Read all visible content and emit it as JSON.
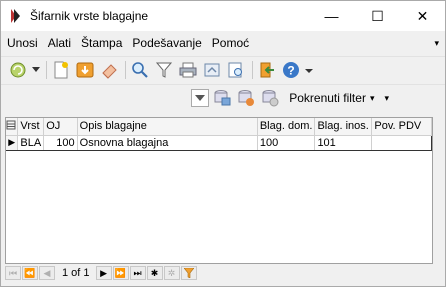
{
  "window": {
    "title": "Šifarnik vrste blagajne"
  },
  "titlebar_controls": {
    "minimize": "—",
    "maximize": "☐",
    "close": "✕"
  },
  "menu": [
    {
      "label": "Unosi"
    },
    {
      "label": "Alati"
    },
    {
      "label": "Štampa"
    },
    {
      "label": "Podešavanje"
    },
    {
      "label": "Pomoć"
    }
  ],
  "menu_overflow": "▾",
  "toolbar1_icons": [
    "refresh-icon",
    "dropdown-arrow-icon",
    "new-document-icon",
    "save-icon",
    "eraser-icon",
    "search-icon",
    "filter-icon",
    "print-icon",
    "export-icon",
    "preview-icon",
    "exit-icon",
    "help-icon",
    "overflow-icon"
  ],
  "toolbar2": {
    "filter_label": "Pokrenuti filter",
    "filter_arrow": "▾",
    "overflow": "▾"
  },
  "grid": {
    "columns": [
      "Vrst",
      "OJ",
      "Opis blagajne",
      "Blag. dom.",
      "Blag. inos.",
      "Pov. PDV"
    ],
    "rows": [
      {
        "indicator": "▶",
        "cells": [
          "BLA",
          "100",
          "Osnovna blagajna",
          "100",
          "101",
          ""
        ]
      }
    ]
  },
  "pager": {
    "text": "1 of 1"
  }
}
